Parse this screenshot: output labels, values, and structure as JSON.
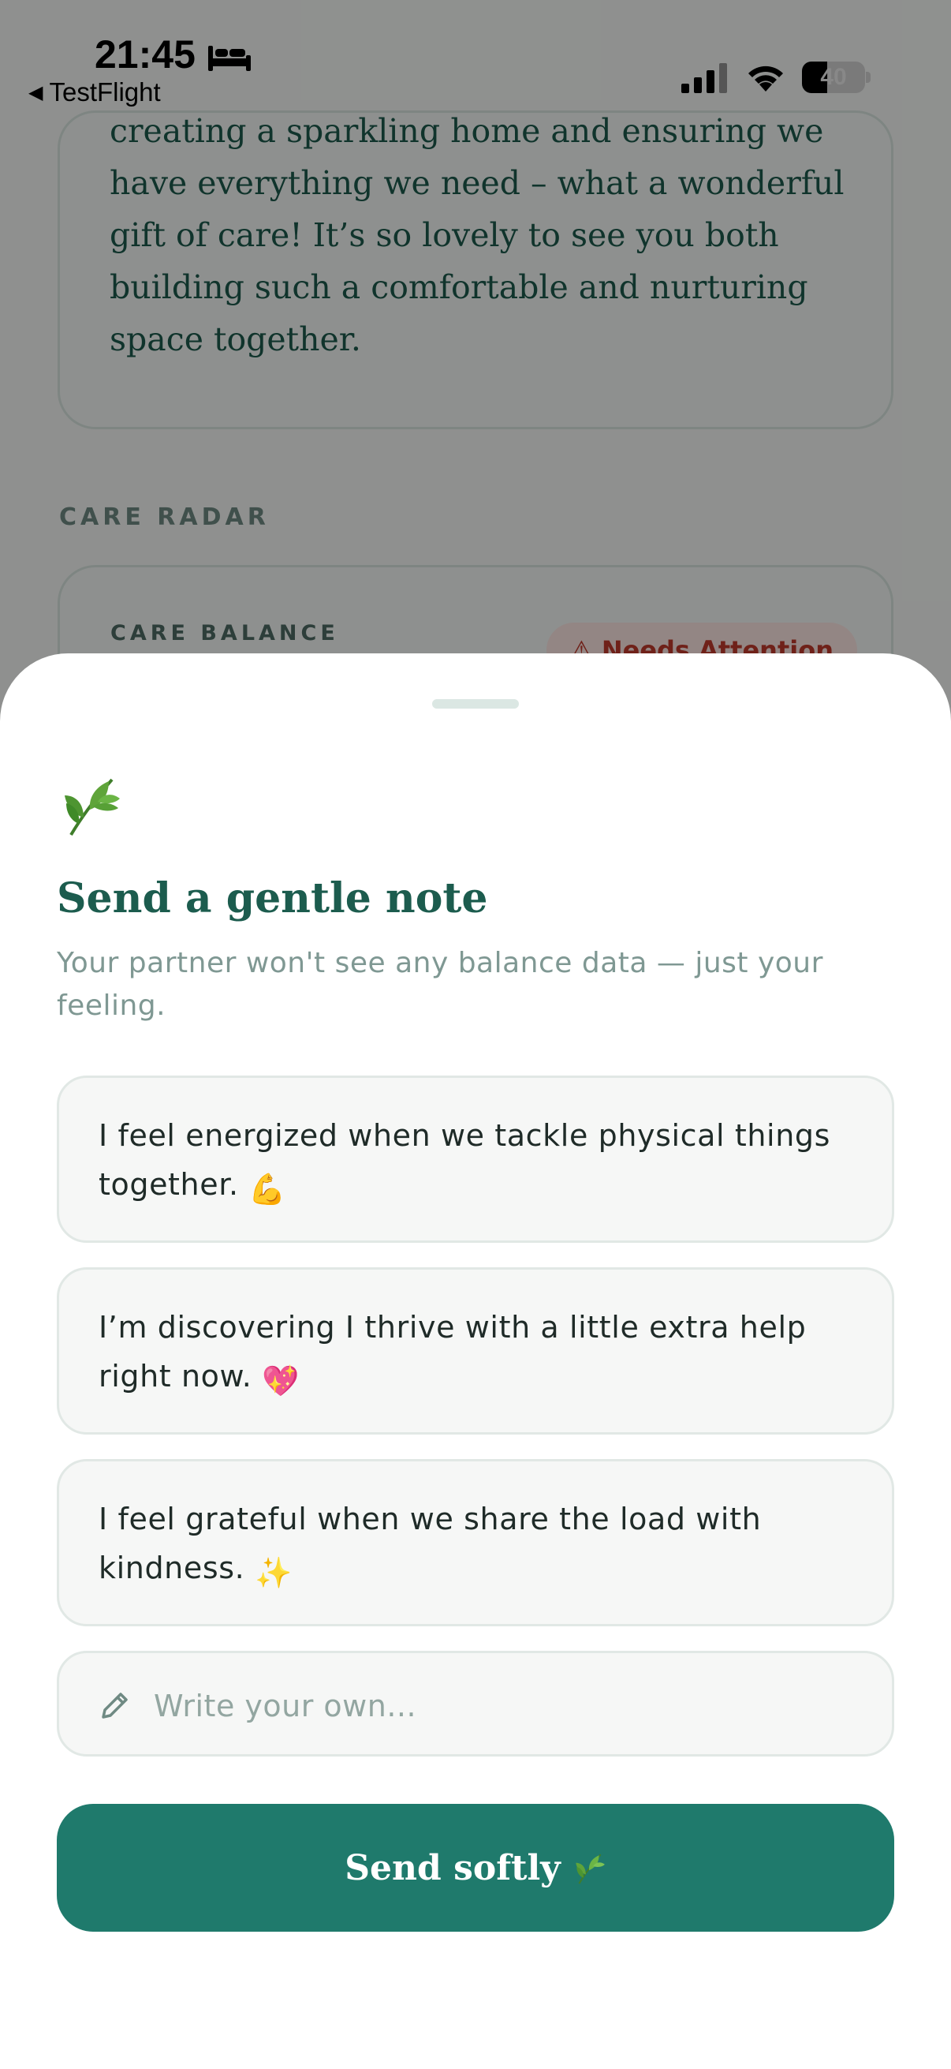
{
  "status_bar": {
    "time": "21:45",
    "back_label": "TestFlight",
    "battery_level": 40,
    "battery_text": "40"
  },
  "background": {
    "message_lines": [
      "creating a sparkling home and ensuring we",
      "have everything we need – what a wonderful",
      "gift of care! It’s so lovely to see you both",
      "building such a comfortable and nurturing",
      "space together."
    ],
    "section_label": "CARE RADAR",
    "radar_card": {
      "label": "CARE BALANCE",
      "badge": "⚠ Needs Attention"
    }
  },
  "sheet": {
    "icon": "leaf-icon",
    "title": "Send a gentle note",
    "subtitle": "Your partner won't see any balance data — just your feeling.",
    "options": [
      {
        "text": "I feel energized when we tackle physical things together.",
        "emoji": "💪"
      },
      {
        "text": "I’m discovering I thrive with a little extra help right now.",
        "emoji": "💖"
      },
      {
        "text": "I feel grateful when we share the load with kindness.",
        "emoji": "✨"
      }
    ],
    "custom_note": {
      "placeholder": "Write your own...",
      "value": ""
    },
    "send_label": "Send softly"
  },
  "colors": {
    "accent": "#1f7a6c",
    "title": "#1c5c4e",
    "subtitle": "#7f9893",
    "option_background": "#f6f7f6",
    "alert": "#c0392b"
  }
}
